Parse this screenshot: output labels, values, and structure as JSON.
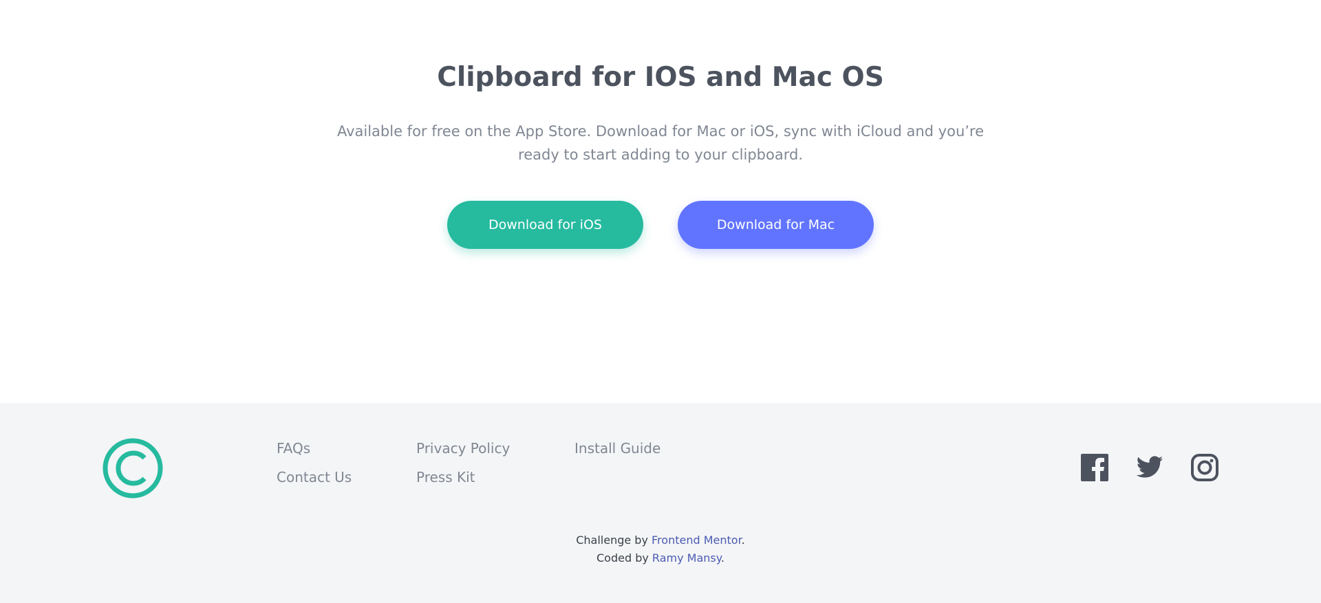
{
  "cta": {
    "title": "Clipboard for IOS and Mac OS",
    "description": "Available for free on the App Store. Download for Mac or iOS, sync with iCloud and you’re ready to start adding to your clipboard.",
    "ios_button_label": "Download for iOS",
    "mac_button_label": "Download for Mac"
  },
  "footer": {
    "logo_icon": "clipboard-logo-icon",
    "links": {
      "faqs": "FAQs",
      "contact_us": "Contact Us",
      "privacy_policy": "Privacy Policy",
      "press_kit": "Press Kit",
      "install_guide": "Install Guide"
    },
    "social": [
      "facebook-icon",
      "twitter-icon",
      "instagram-icon"
    ],
    "attribution": {
      "challenge_prefix": "Challenge by ",
      "challenge_link": "Frontend Mentor",
      "challenge_suffix": ".",
      "coded_prefix": "Coded by ",
      "coded_link": "Ramy Mansy",
      "coded_suffix": "."
    }
  },
  "colors": {
    "accent_green": "#26ba9f",
    "accent_blue": "#6174ff",
    "heading": "#4c535e",
    "text_muted": "#808792",
    "footer_bg": "#f4f5f7",
    "link_blue": "#4b5bb3"
  }
}
